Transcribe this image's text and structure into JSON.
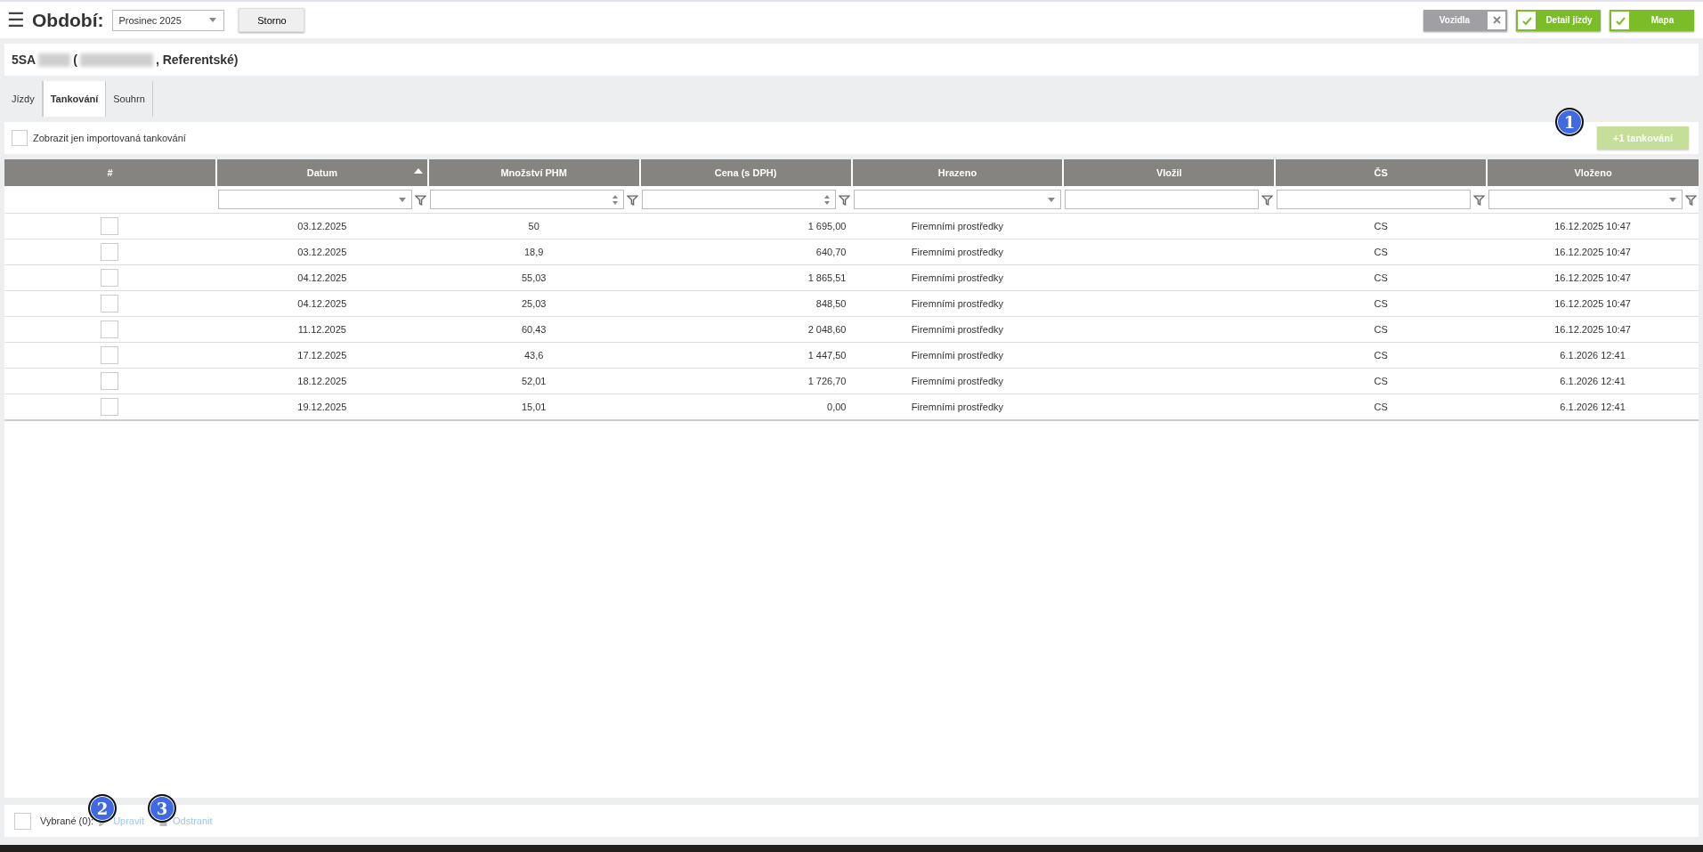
{
  "header": {
    "menu_icon": "☰",
    "period_label": "Období:",
    "period_value": "Prosinec 2025",
    "cancel_button": "Storno",
    "toggles": [
      {
        "label": "Vozidla",
        "on": false
      },
      {
        "label": "Detail jízdy",
        "on": true
      },
      {
        "label": "Mapa",
        "on": true
      }
    ]
  },
  "vehicle_title": {
    "plate_start": "5SA",
    "open_paren": "(",
    "suffix": ", Referentské)"
  },
  "tabs": [
    {
      "label": "Jízdy",
      "selected": false
    },
    {
      "label": "Tankování",
      "selected": true
    },
    {
      "label": "Souhrn",
      "selected": false
    }
  ],
  "filter_bar": {
    "checkbox_label": "Zobrazit jen importovaná tankování",
    "checked": false,
    "add_button": {
      "label": "+1 tankování",
      "disabled": true,
      "badge": "1"
    }
  },
  "table": {
    "columns": [
      {
        "label": "#",
        "kind": "plain",
        "filter_button": false,
        "sorted_ascending": false
      },
      {
        "label": "Datum",
        "kind": "select",
        "filter_button": true,
        "sorted_ascending": true
      },
      {
        "label": "Množství PHM",
        "kind": "number",
        "filter_button": true,
        "sorted_ascending": false
      },
      {
        "label": "Cena (s DPH)",
        "kind": "amount",
        "filter_button": true,
        "sorted_ascending": false
      },
      {
        "label": "Hrazeno",
        "kind": "select",
        "filter_button": false,
        "sorted_ascending": false
      },
      {
        "label": "Vložil",
        "kind": "text",
        "filter_button": true,
        "sorted_ascending": false
      },
      {
        "label": "ČS",
        "kind": "text",
        "filter_button": true,
        "sorted_ascending": false
      },
      {
        "label": "Vloženo",
        "kind": "select",
        "filter_button": true,
        "sorted_ascending": false
      }
    ],
    "rows": [
      {
        "checked": false,
        "cells": [
          "",
          "03.12.2025",
          "50",
          "1 695,00",
          "Firemními prostředky",
          "",
          "CS",
          "16.12.2025 10:47"
        ]
      },
      {
        "checked": false,
        "cells": [
          "",
          "03.12.2025",
          "18,9",
          "640,70",
          "Firemními prostředky",
          "",
          "CS",
          "16.12.2025 10:47"
        ]
      },
      {
        "checked": false,
        "cells": [
          "",
          "04.12.2025",
          "55,03",
          "1 865,51",
          "Firemními prostředky",
          "",
          "CS",
          "16.12.2025 10:47"
        ]
      },
      {
        "checked": false,
        "cells": [
          "",
          "04.12.2025",
          "25,03",
          "848,50",
          "Firemními prostředky",
          "",
          "CS",
          "16.12.2025 10:47"
        ]
      },
      {
        "checked": false,
        "cells": [
          "",
          "11.12.2025",
          "60,43",
          "2 048,60",
          "Firemními prostředky",
          "",
          "CS",
          "16.12.2025 10:47"
        ]
      },
      {
        "checked": false,
        "cells": [
          "",
          "17.12.2025",
          "43,6",
          "1 447,50",
          "Firemními prostředky",
          "",
          "CS",
          "6.1.2026 12:41"
        ]
      },
      {
        "checked": false,
        "cells": [
          "",
          "18.12.2025",
          "52,01",
          "1 726,70",
          "Firemními prostředky",
          "",
          "CS",
          "6.1.2026 12:41"
        ]
      },
      {
        "checked": false,
        "cells": [
          "",
          "19.12.2025",
          "15,01",
          "0,00",
          "Firemními prostředky",
          "",
          "CS",
          "6.1.2026 12:41"
        ]
      }
    ]
  },
  "footer": {
    "checked": false,
    "selected_label": "Vybrané (0):",
    "actions": [
      {
        "kind": "edit",
        "label": "Upravit",
        "disabled": true,
        "badge": "2"
      },
      {
        "kind": "delete",
        "label": "Odstranit",
        "disabled": true,
        "badge": "3"
      }
    ]
  }
}
